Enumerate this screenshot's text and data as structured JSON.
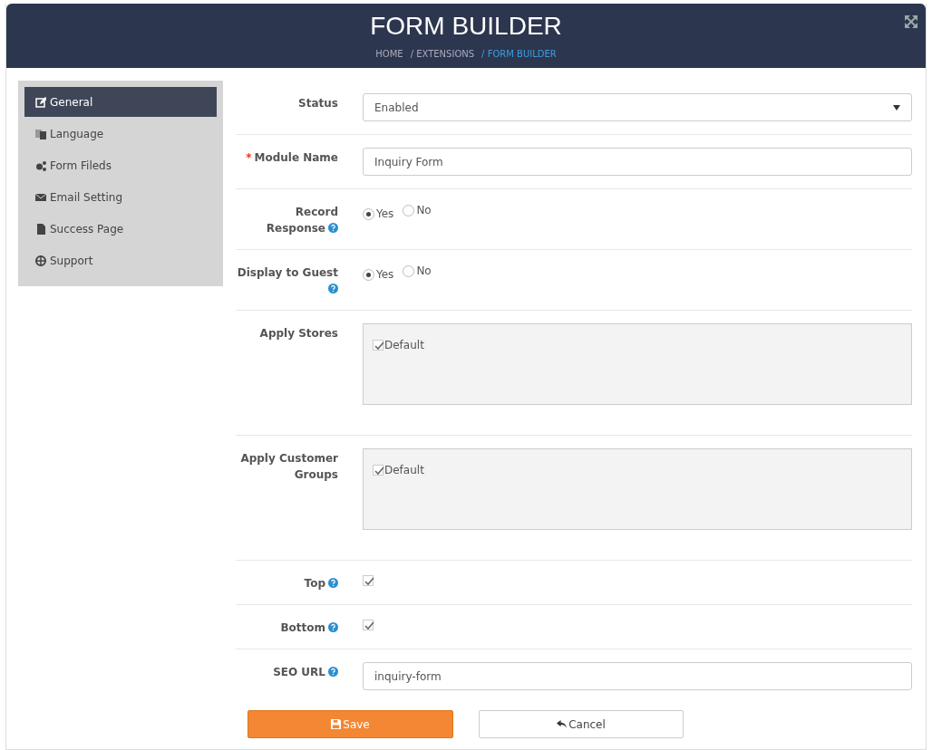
{
  "header": {
    "title": "FORM BUILDER",
    "breadcrumbs": [
      {
        "label": "HOME",
        "selected": false
      },
      {
        "label": "/ EXTENSIONS",
        "selected": false
      },
      {
        "label": "/ FORM BUILDER",
        "selected": true
      }
    ]
  },
  "sidebar": {
    "items": [
      {
        "label": "General",
        "selected": true
      },
      {
        "label": "Language",
        "selected": false
      },
      {
        "label": "Form Fileds",
        "selected": false
      },
      {
        "label": "Email Setting",
        "selected": false
      },
      {
        "label": "Success Page",
        "selected": false
      },
      {
        "label": "Support",
        "selected": false
      }
    ]
  },
  "fields": [
    {
      "kind": "select",
      "label": "Status",
      "help": false,
      "value": "Enabled"
    },
    {
      "kind": "text",
      "label": "Module Name",
      "required_mark": "*",
      "help": false,
      "value": "Inquiry Form"
    },
    {
      "kind": "radio",
      "label": "Record Response",
      "help": true,
      "options": [
        {
          "label": "Yes",
          "selected": true
        },
        {
          "label": "No",
          "selected": false
        }
      ]
    },
    {
      "kind": "radio",
      "label": "Display to Guest",
      "help": true,
      "options": [
        {
          "label": "Yes",
          "selected": true
        },
        {
          "label": "No",
          "selected": false
        }
      ]
    },
    {
      "kind": "checklist",
      "label": "Apply Stores",
      "help": false,
      "options": [
        {
          "label": "Default",
          "checked": true
        }
      ]
    },
    {
      "kind": "checklist",
      "label": "Apply Customer Groups",
      "help": false,
      "options": [
        {
          "label": "Default",
          "checked": true
        }
      ]
    },
    {
      "kind": "checkbox",
      "label": "Top",
      "help": true,
      "checked": true
    },
    {
      "kind": "checkbox",
      "label": "Bottom",
      "help": true,
      "checked": true
    },
    {
      "kind": "text",
      "label": "SEO URL",
      "help": true,
      "value": "inquiry-form"
    }
  ],
  "buttons": [
    {
      "kind": "primary",
      "label": "Save"
    },
    {
      "kind": "secondary",
      "label": "Cancel"
    }
  ]
}
